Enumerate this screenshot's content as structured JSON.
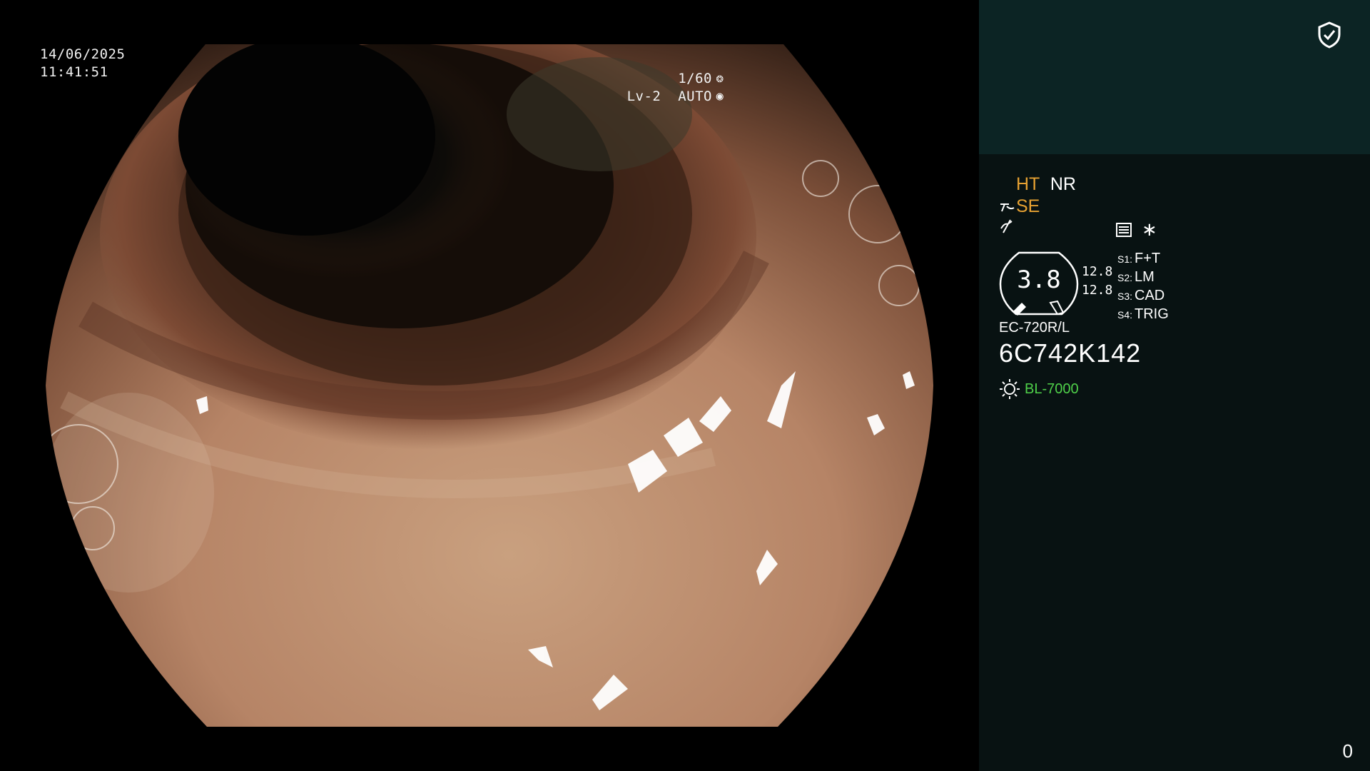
{
  "image_view": {
    "date": "14/06/2025",
    "time": "11:41:51",
    "shutter": "1/60",
    "shutter_icon": "aperture-icon",
    "iris": "Lv-2  AUTO",
    "iris_icon": "iris-icon"
  },
  "panel": {
    "shield_icon": "shield-check-icon",
    "enhancement": {
      "ht": "HT",
      "nr": "NR"
    },
    "structure": "SE",
    "structure_icon": "structure-enhance-icon",
    "misc_icon": "contrast-icon",
    "mode_icons": [
      "settings-list-icon",
      "asterisk-icon"
    ],
    "gauge": {
      "value": "3.8",
      "upper": "12.8",
      "lower": "12.8"
    },
    "switches": [
      {
        "key": "S1:",
        "value": "F+T"
      },
      {
        "key": "S2:",
        "value": "LM"
      },
      {
        "key": "S3:",
        "value": "CAD"
      },
      {
        "key": "S4:",
        "value": "TRIG"
      }
    ],
    "scope_model": "EC-720R/L",
    "scope_serial": "6C742K142",
    "light_source": "BL-7000",
    "light_icon": "light-source-icon",
    "counter": "0"
  },
  "colors": {
    "panel_bg": "#081212",
    "panel_top_bg": "#0c2424",
    "orange": "#e6a132",
    "green": "#4fd14a"
  }
}
